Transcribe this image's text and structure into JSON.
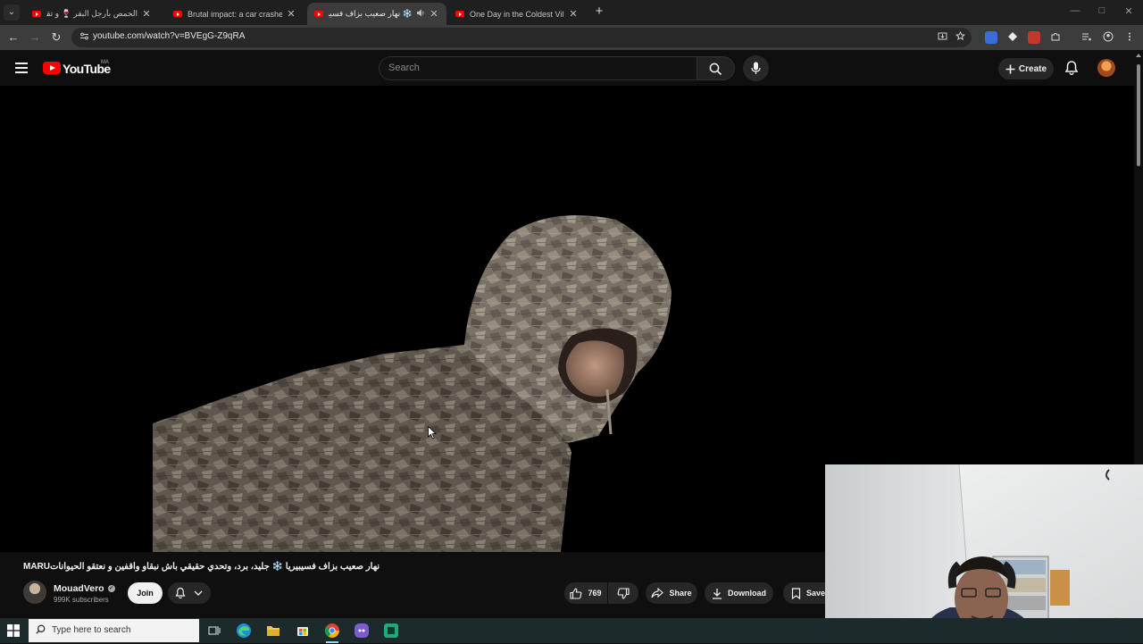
{
  "browser": {
    "tabs": [
      {
        "title": "الحمص بأرجل البقر 🍷 و تقليم أ...",
        "active": false,
        "audio": false
      },
      {
        "title": "Brutal impact: a car crashes...",
        "active": false,
        "audio": false
      },
      {
        "title": "❄️ نهار صعيب بزاف فسيبيريا",
        "active": true,
        "audio": true
      },
      {
        "title": "One Day in the Coldest Village...",
        "active": false,
        "audio": false
      }
    ],
    "url": "youtube.com/watch?v=BVEgG-Z9qRA",
    "icons": {
      "back": "←",
      "forward": "→",
      "reload": "↻",
      "new_tab": "+",
      "close": "✕",
      "tab_menu": "⌄",
      "minimize": "—",
      "maximize": "□",
      "window_close": "✕"
    }
  },
  "youtube": {
    "logo_text": "YouTube",
    "country_code": "MA",
    "search_placeholder": "Search",
    "create_label": "Create"
  },
  "video": {
    "title": "MARUنهار صعيب بزاف فسيبيريا ❄️ جليد، برد، وتحدي حقيقي باش نبقاو واقفين و نعتقو الحيوانات",
    "channel": "MouadVero",
    "subscribers": "999K subscribers",
    "join_label": "Join",
    "likes": "769",
    "share_label": "Share",
    "download_label": "Download",
    "save_label": "Save"
  },
  "taskbar": {
    "search_placeholder": "Type here to search"
  },
  "colors": {
    "youtube_red": "#ff0000",
    "page_bg": "#0f0f0f",
    "chrome_toolbar": "#3c3c3c",
    "taskbar": "#1c2a2c"
  }
}
